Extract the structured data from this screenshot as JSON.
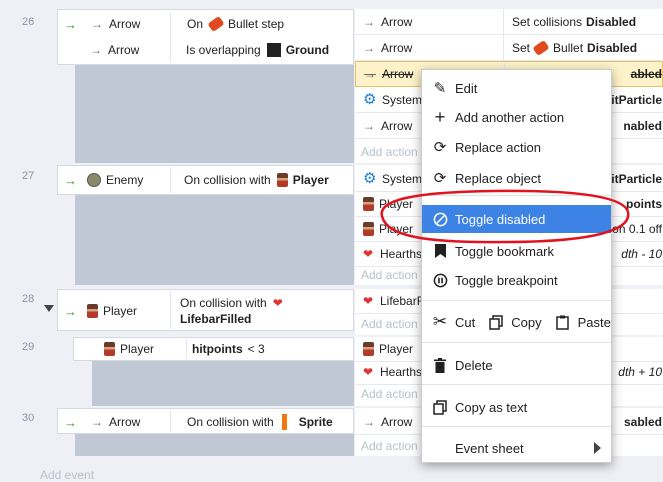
{
  "events": [
    {
      "number": "26"
    },
    {
      "number": "27"
    },
    {
      "number": "28"
    },
    {
      "number": "29"
    },
    {
      "number": "30"
    }
  ],
  "conditions": {
    "e26a": {
      "object": "Arrow",
      "text1": "On",
      "subject": "Bullet step"
    },
    "e26b": {
      "object": "Arrow",
      "text1": "Is overlapping",
      "subject": "Ground"
    },
    "e27": {
      "object": "Enemy",
      "text1": "On collision with",
      "subject": "Player"
    },
    "e28": {
      "object": "Player",
      "text1": "On collision with",
      "subject": "LifebarFilled"
    },
    "e29": {
      "object": "Player",
      "subject": "hitpoints",
      "text2": "< 3"
    },
    "e30": {
      "object": "Arrow",
      "text1": "On collision with",
      "subject": "Sprite"
    }
  },
  "actions": {
    "r1": {
      "object": "Arrow",
      "right_prefix": "Set collisions",
      "right_bold": "Disabled"
    },
    "r2": {
      "object": "Arrow",
      "right_prefix": "Set",
      "right_mid": "Bullet",
      "right_bold": "Disabled"
    },
    "r3": {
      "object": "Arrow",
      "right_bold": "abled"
    },
    "r4": {
      "object": "System",
      "right_bold": "litParticle"
    },
    "r5": {
      "object": "Arrow",
      "right_bold": "nabled"
    },
    "r6": {
      "object": "System",
      "right_bold": "litParticle"
    },
    "r7": {
      "object": "Player",
      "right_bold": "points"
    },
    "r8": {
      "object": "Player",
      "right_text": "on 0.1 off"
    },
    "r9": {
      "object": "Hearths",
      "right_text": "dth - 10"
    },
    "r10": {
      "object": "LifebarF"
    },
    "r11": {
      "object": "Player"
    },
    "r12": {
      "object": "Hearths",
      "right_text": "dth + 10"
    },
    "r13": {
      "object": "Arrow",
      "right_bold": "sabled"
    }
  },
  "add_action_label": "Add action",
  "add_event_label": "Add event",
  "context_menu": {
    "edit": "Edit",
    "add_another_action": "Add another action",
    "replace_action": "Replace action",
    "replace_object": "Replace object",
    "toggle_disabled": "Toggle disabled",
    "toggle_bookmark": "Toggle bookmark",
    "toggle_breakpoint": "Toggle breakpoint",
    "cut": "Cut",
    "copy": "Copy",
    "paste": "Paste",
    "delete": "Delete",
    "copy_as_text": "Copy as text",
    "event_sheet": "Event sheet"
  },
  "colors": {
    "highlight": "#3d82e5",
    "annotation": "#e0141e",
    "selected_row": "#fdf2c8"
  }
}
